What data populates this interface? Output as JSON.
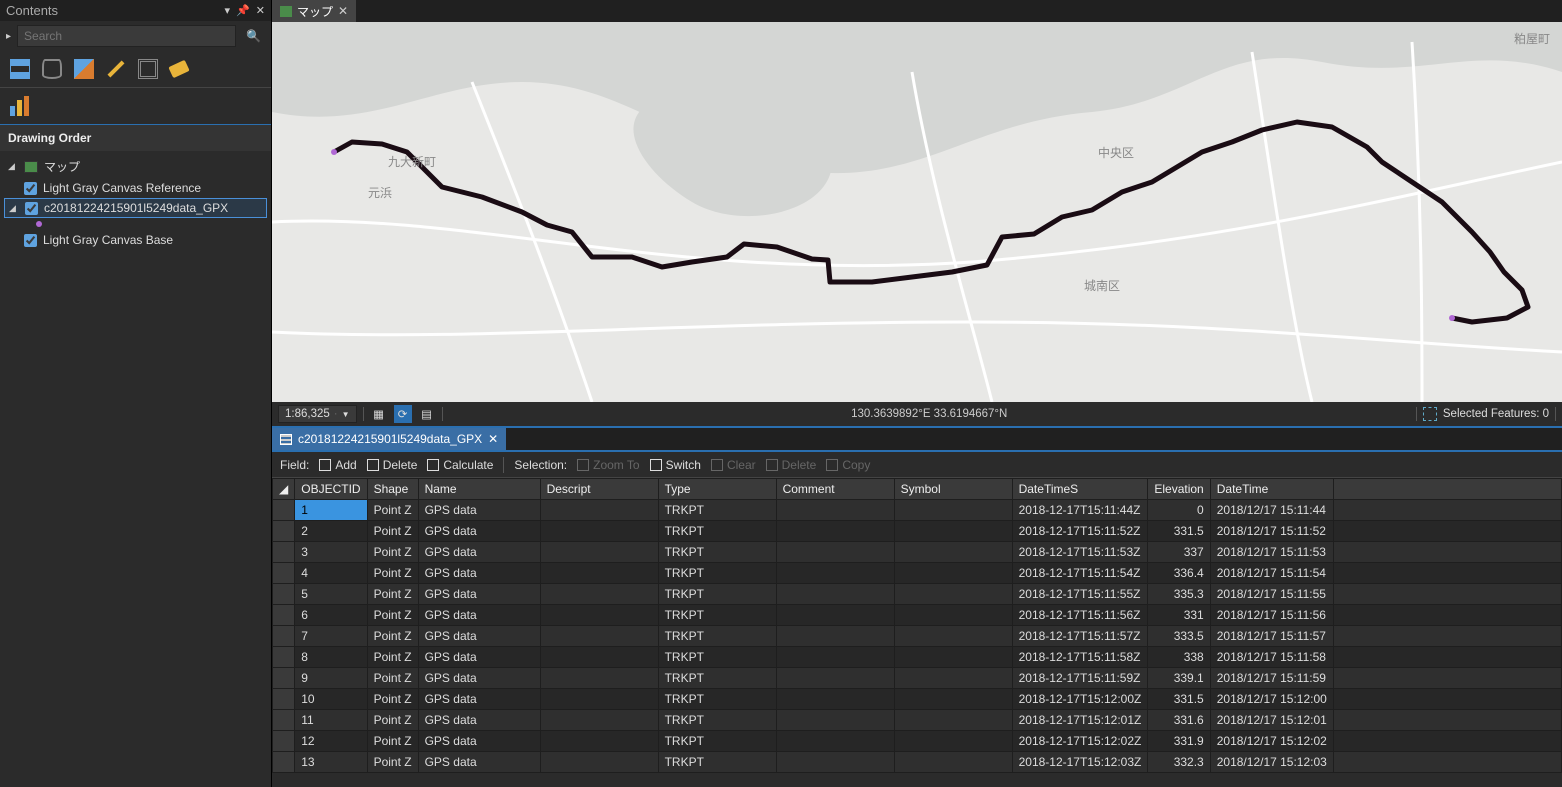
{
  "contents": {
    "title": "Contents",
    "search_placeholder": "Search",
    "section": "Drawing Order",
    "tree": {
      "map_label": "マップ",
      "items": [
        "Light Gray Canvas Reference",
        "c20181224215901l5249data_GPX",
        "Light Gray Canvas Base"
      ]
    }
  },
  "map": {
    "tab_label": "マップ",
    "labels": {
      "kasayamachi": "粕屋町",
      "kyudaishin": "九大新町",
      "motohama": "元浜",
      "chuoku": "中央区",
      "jonanku": "城南区"
    },
    "status": {
      "scale": "1:86,325",
      "coords": "130.3639892°E 33.6194667°N",
      "selected_label": "Selected Features: 0"
    }
  },
  "table": {
    "tab_label": "c20181224215901l5249data_GPX",
    "toolbar": {
      "field_label": "Field:",
      "add": "Add",
      "delete": "Delete",
      "calculate": "Calculate",
      "selection_label": "Selection:",
      "zoomto": "Zoom To",
      "switch": "Switch",
      "clear": "Clear",
      "delete2": "Delete",
      "copy": "Copy"
    },
    "columns": [
      "OBJECTID",
      "Shape",
      "Name",
      "Descript",
      "Type",
      "Comment",
      "Symbol",
      "DateTimeS",
      "Elevation",
      "DateTime"
    ],
    "rows": [
      {
        "id": 1,
        "shape": "Point Z",
        "name": "GPS data",
        "type": "TRKPT",
        "dts": "2018-12-17T15:11:44Z",
        "elev": "0",
        "dt": "2018/12/17 15:11:44"
      },
      {
        "id": 2,
        "shape": "Point Z",
        "name": "GPS data",
        "type": "TRKPT",
        "dts": "2018-12-17T15:11:52Z",
        "elev": "331.5",
        "dt": "2018/12/17 15:11:52"
      },
      {
        "id": 3,
        "shape": "Point Z",
        "name": "GPS data",
        "type": "TRKPT",
        "dts": "2018-12-17T15:11:53Z",
        "elev": "337",
        "dt": "2018/12/17 15:11:53"
      },
      {
        "id": 4,
        "shape": "Point Z",
        "name": "GPS data",
        "type": "TRKPT",
        "dts": "2018-12-17T15:11:54Z",
        "elev": "336.4",
        "dt": "2018/12/17 15:11:54"
      },
      {
        "id": 5,
        "shape": "Point Z",
        "name": "GPS data",
        "type": "TRKPT",
        "dts": "2018-12-17T15:11:55Z",
        "elev": "335.3",
        "dt": "2018/12/17 15:11:55"
      },
      {
        "id": 6,
        "shape": "Point Z",
        "name": "GPS data",
        "type": "TRKPT",
        "dts": "2018-12-17T15:11:56Z",
        "elev": "331",
        "dt": "2018/12/17 15:11:56"
      },
      {
        "id": 7,
        "shape": "Point Z",
        "name": "GPS data",
        "type": "TRKPT",
        "dts": "2018-12-17T15:11:57Z",
        "elev": "333.5",
        "dt": "2018/12/17 15:11:57"
      },
      {
        "id": 8,
        "shape": "Point Z",
        "name": "GPS data",
        "type": "TRKPT",
        "dts": "2018-12-17T15:11:58Z",
        "elev": "338",
        "dt": "2018/12/17 15:11:58"
      },
      {
        "id": 9,
        "shape": "Point Z",
        "name": "GPS data",
        "type": "TRKPT",
        "dts": "2018-12-17T15:11:59Z",
        "elev": "339.1",
        "dt": "2018/12/17 15:11:59"
      },
      {
        "id": 10,
        "shape": "Point Z",
        "name": "GPS data",
        "type": "TRKPT",
        "dts": "2018-12-17T15:12:00Z",
        "elev": "331.5",
        "dt": "2018/12/17 15:12:00"
      },
      {
        "id": 11,
        "shape": "Point Z",
        "name": "GPS data",
        "type": "TRKPT",
        "dts": "2018-12-17T15:12:01Z",
        "elev": "331.6",
        "dt": "2018/12/17 15:12:01"
      },
      {
        "id": 12,
        "shape": "Point Z",
        "name": "GPS data",
        "type": "TRKPT",
        "dts": "2018-12-17T15:12:02Z",
        "elev": "331.9",
        "dt": "2018/12/17 15:12:02"
      },
      {
        "id": 13,
        "shape": "Point Z",
        "name": "GPS data",
        "type": "TRKPT",
        "dts": "2018-12-17T15:12:03Z",
        "elev": "332.3",
        "dt": "2018/12/17 15:12:03"
      }
    ]
  }
}
